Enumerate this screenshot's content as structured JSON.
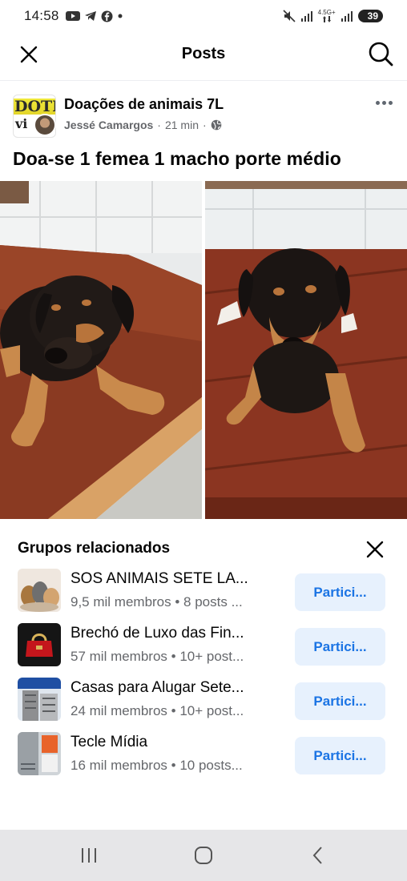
{
  "status_bar": {
    "time": "14:58",
    "network_label_top": "4.5G+",
    "battery": "39",
    "icons": [
      "youtube-icon",
      "telegram-icon",
      "facebook-icon",
      "dot-icon",
      "mute-icon",
      "signal-icon",
      "data-arrows-icon",
      "signal-icon",
      "battery-icon"
    ]
  },
  "header": {
    "title": "Posts",
    "left_icon": "close-icon",
    "right_icon": "search-icon"
  },
  "post": {
    "group_name": "Doações de animais 7L",
    "avatar_text_top": "DOTI",
    "avatar_text_bottom": "vi",
    "author": "Jessé Camargos",
    "separator": "·",
    "time": "21 min",
    "separator2": "·",
    "privacy_icon": "globe-icon",
    "text": "Doa-se 1 femea 1 macho porte médio",
    "photos": [
      "puppy-photo-left",
      "puppy-photo-right"
    ]
  },
  "related": {
    "title": "Grupos relacionados",
    "groups": [
      {
        "name": "SOS ANIMAIS SETE LA...",
        "meta": "9,5 mil membros • 8 posts ...",
        "button": "Partici..."
      },
      {
        "name": "Brechó de Luxo das Fin...",
        "meta": "57 mil membros • 10+ post...",
        "button": "Partici..."
      },
      {
        "name": "Casas para Alugar Sete...",
        "meta": "24 mil membros • 10+ post...",
        "button": "Partici..."
      },
      {
        "name": "Tecle Mídia",
        "meta": "16 mil membros • 10 posts...",
        "button": "Partici..."
      }
    ]
  },
  "nav": {
    "items": [
      "recents-icon",
      "home-icon",
      "back-icon"
    ]
  }
}
